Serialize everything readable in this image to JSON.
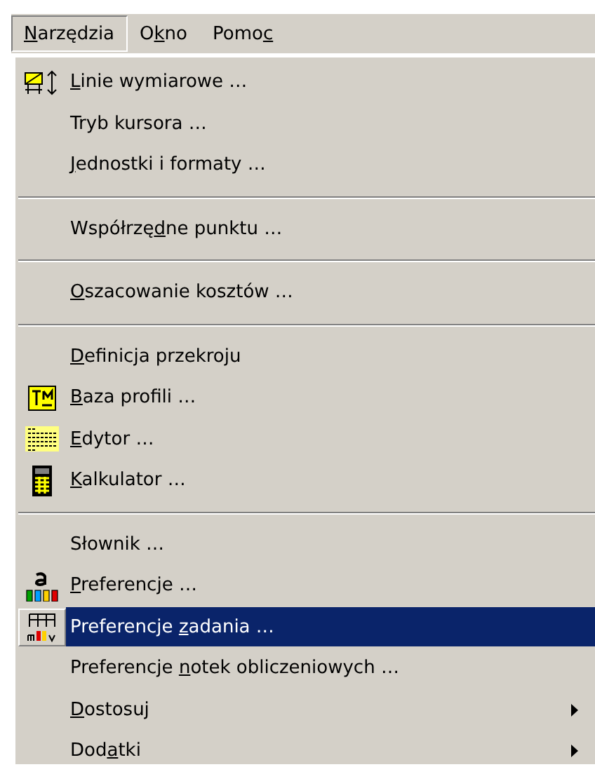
{
  "menu_bar": [
    {
      "key": "N",
      "after": "arzędzia",
      "selected": true
    },
    {
      "before": "O",
      "key": "k",
      "after": "no",
      "selected": false
    },
    {
      "before": "Pomo",
      "key": "c",
      "selected": false
    }
  ],
  "menu": [
    {
      "kind": "dimension",
      "key": "L",
      "after": "inie wymiarowe …",
      "selected": false,
      "submenu": false
    },
    {
      "kind": "plain",
      "before": "Tryb kursora …",
      "selected": false,
      "submenu": false
    },
    {
      "kind": "plain",
      "key": "J",
      "after": "ednostki i formaty …",
      "selected": false,
      "submenu": false
    },
    {
      "kind": "separator"
    },
    {
      "kind": "plain",
      "before": "Współrzę",
      "key": "d",
      "after": "ne punktu …",
      "selected": false,
      "submenu": false
    },
    {
      "kind": "separator"
    },
    {
      "kind": "plain",
      "key": "O",
      "after": "szacowanie kosztów …",
      "selected": false,
      "submenu": false
    },
    {
      "kind": "separator"
    },
    {
      "kind": "plain",
      "key": "D",
      "after": "efinicja przekroju",
      "selected": false,
      "submenu": false
    },
    {
      "kind": "profile",
      "key": "B",
      "after": "aza profili …",
      "selected": false,
      "submenu": false
    },
    {
      "kind": "editor",
      "key": "E",
      "after": "dytor …",
      "selected": false,
      "submenu": false
    },
    {
      "kind": "calculator",
      "key": "K",
      "after": "alkulator …",
      "selected": false,
      "submenu": false
    },
    {
      "kind": "separator"
    },
    {
      "kind": "plain",
      "before": "Słownik …",
      "selected": false,
      "submenu": false
    },
    {
      "kind": "bars",
      "key": "P",
      "after": "referencje …",
      "selected": false,
      "submenu": false
    },
    {
      "kind": "grid",
      "before": "Preferencje ",
      "key": "z",
      "after": "adania …",
      "selected": true,
      "submenu": false
    },
    {
      "kind": "plain",
      "before": "Preferencje ",
      "key": "n",
      "after": "otek obliczeniowych …",
      "selected": false,
      "submenu": false
    },
    {
      "kind": "plain",
      "key": "D",
      "after": "ostosuj",
      "selected": false,
      "submenu": true
    },
    {
      "kind": "plain",
      "before": "Dod",
      "key": "a",
      "after": "tki",
      "selected": false,
      "submenu": true
    }
  ]
}
